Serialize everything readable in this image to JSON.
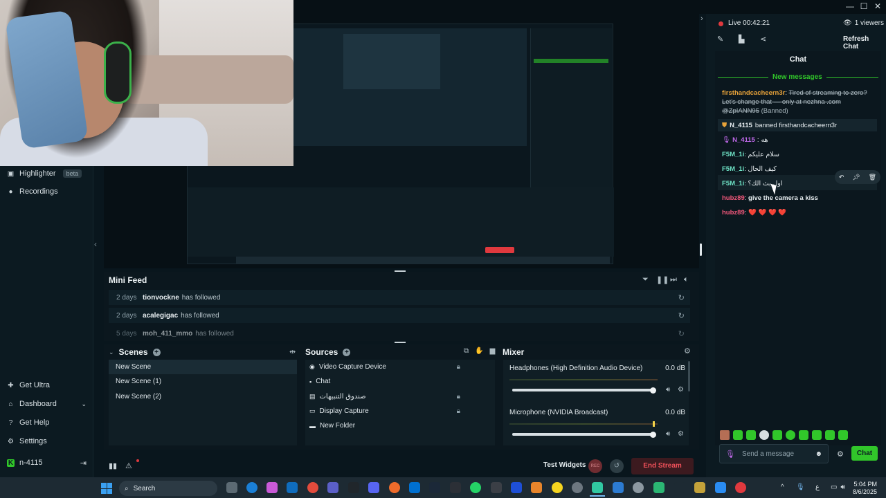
{
  "window": {
    "minimize": "—",
    "maximize": "☐",
    "close": "✕"
  },
  "nav": {
    "highlighter": "Highlighter",
    "beta": "beta",
    "recordings": "Recordings",
    "get_ultra": "Get Ultra",
    "dashboard": "Dashboard",
    "get_help": "Get Help",
    "settings": "Settings",
    "user": "n-4115"
  },
  "mini_feed": {
    "title": "Mini Feed",
    "rows": [
      {
        "ago": "2 days",
        "who": "tionvockne",
        "what": "has followed"
      },
      {
        "ago": "2 days",
        "who": "acalegigac",
        "what": "has followed"
      },
      {
        "ago": "5 days",
        "who": "moh_411_mmo",
        "what": "has followed"
      }
    ]
  },
  "scenes": {
    "title": "Scenes",
    "items": [
      "New Scene",
      "New Scene (1)",
      "New Scene (2)"
    ]
  },
  "sources": {
    "title": "Sources",
    "items": [
      "Video Capture Device",
      "Chat",
      "صندوق التنبيهات",
      "Display Capture",
      "New Folder"
    ]
  },
  "mixer": {
    "title": "Mixer",
    "channels": [
      {
        "name": "Headphones (High Definition Audio Device)",
        "db": "0.0 dB",
        "level": 1.0
      },
      {
        "name": "Microphone (NVIDIA Broadcast)",
        "db": "0.0 dB",
        "level": 1.0
      }
    ]
  },
  "footer": {
    "test_widgets": "Test Widgets",
    "rec": "REC",
    "end_stream": "End Stream"
  },
  "chat": {
    "live_label": "Live",
    "live_time": "00:42:21",
    "viewers": "1 viewers",
    "refresh": "Refresh Chat",
    "title": "Chat",
    "new_messages": "New messages",
    "messages": [
      {
        "user": "firsthandcacheern3r",
        "text": "Tired of streaming to zero? Let's change that — only at nezhna .com @ZpIANN95",
        "suffix": "(Banned)",
        "color": "#e8a33a",
        "struck": true
      },
      {
        "user": "N_4115",
        "text": "banned firsthandcacheern3r",
        "color": "#e7edf0",
        "system": true
      },
      {
        "user": "N_4115",
        "text": "هه",
        "color": "#c069ea"
      },
      {
        "user": "F5M_1i",
        "text": "سلام عليكم",
        "color": "#6fe3c6"
      },
      {
        "user": "F5M_1i",
        "text": "كيف الحال",
        "color": "#6fe3c6"
      },
      {
        "user": "F5M_1i",
        "text": "اول بث الك؟",
        "color": "#6fe3c6"
      },
      {
        "user": "hubz89",
        "text": "give the camera a kiss",
        "color": "#f0577a"
      },
      {
        "user": "hubz89",
        "text": "❤️ ❤️ ❤️ ❤️",
        "color": "#f0577a"
      }
    ],
    "input_placeholder": "Send a message",
    "send": "Chat"
  },
  "taskbar": {
    "search": "Search",
    "time": "5:04 PM",
    "date": "8/6/2025",
    "lang": "ع"
  },
  "colors": {
    "accent": "#31c62a",
    "end_stream": "#e0393e",
    "bg": "#09161d"
  }
}
